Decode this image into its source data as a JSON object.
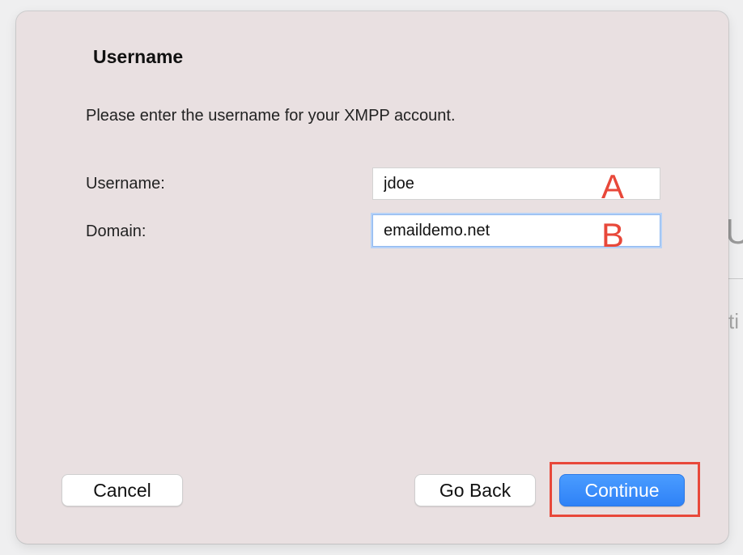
{
  "background_window": {
    "fragment_u": "U",
    "fragment_ti": "ti"
  },
  "dialog": {
    "title": "Username",
    "description": "Please enter the username for your XMPP account."
  },
  "fields": {
    "username": {
      "label": "Username:",
      "value": "jdoe",
      "marker": "A"
    },
    "domain": {
      "label": "Domain:",
      "value": "emaildemo.net",
      "marker": "B",
      "focused": true
    }
  },
  "buttons": {
    "cancel": "Cancel",
    "go_back": "Go Back",
    "continue": "Continue"
  },
  "colors": {
    "accent": "#2f82f7",
    "annotation": "#e8483a",
    "sheet_background": "#e9e0e1"
  }
}
